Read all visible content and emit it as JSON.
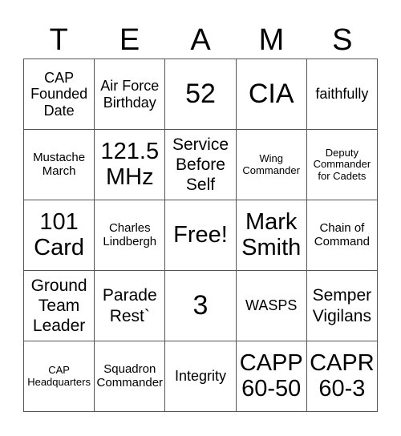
{
  "title_letters": [
    "T",
    "E",
    "A",
    "M",
    "S"
  ],
  "cells": [
    {
      "text": "CAP Founded Date",
      "size": "s-md"
    },
    {
      "text": "Air Force Birthday",
      "size": "s-md"
    },
    {
      "text": "52",
      "size": "s-3xl"
    },
    {
      "text": "CIA",
      "size": "s-3xl"
    },
    {
      "text": "faithfully",
      "size": "s-md"
    },
    {
      "text": "Mustache March",
      "size": "s-sm"
    },
    {
      "text": "121.5 MHz",
      "size": "s-2xl"
    },
    {
      "text": "Service Before Self",
      "size": "s-lg"
    },
    {
      "text": "Wing Commander",
      "size": "s-xs"
    },
    {
      "text": "Deputy Commander for Cadets",
      "size": "s-xs"
    },
    {
      "text": "101 Card",
      "size": "s-2xl"
    },
    {
      "text": "Charles Lindbergh",
      "size": "s-sm"
    },
    {
      "text": "Free!",
      "size": "s-2xl"
    },
    {
      "text": "Mark Smith",
      "size": "s-2xl"
    },
    {
      "text": "Chain of Command",
      "size": "s-sm"
    },
    {
      "text": "Ground Team Leader",
      "size": "s-lg"
    },
    {
      "text": "Parade Rest`",
      "size": "s-lg"
    },
    {
      "text": "3",
      "size": "s-3xl"
    },
    {
      "text": "WASPS",
      "size": "s-md"
    },
    {
      "text": "Semper Vigilans",
      "size": "s-lg"
    },
    {
      "text": "CAP Headquarters",
      "size": "s-xs"
    },
    {
      "text": "Squadron Commander",
      "size": "s-sm"
    },
    {
      "text": "Integrity",
      "size": "s-md"
    },
    {
      "text": "CAPP 60-50",
      "size": "s-2xl"
    },
    {
      "text": "CAPR 60-3",
      "size": "s-2xl"
    }
  ]
}
